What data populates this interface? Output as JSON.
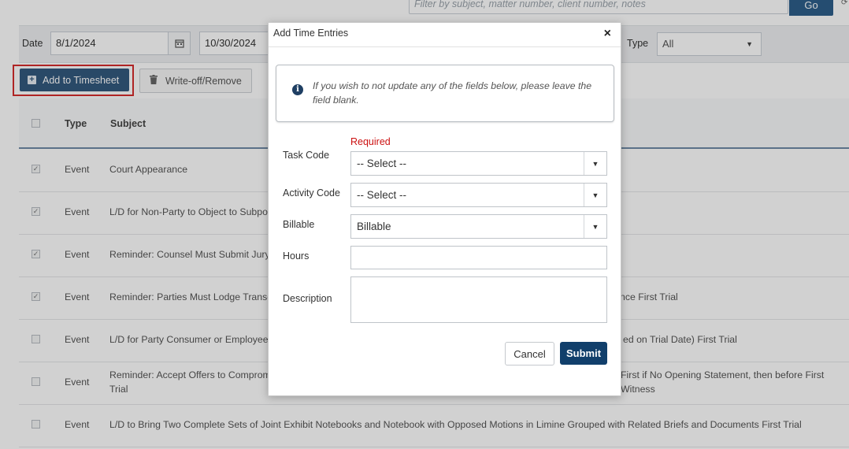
{
  "topbar": {
    "filter_placeholder": "Filter by subject, matter number, client number, notes",
    "go_label": "Go"
  },
  "filters": {
    "date_label": "Date",
    "start_date": "8/1/2024",
    "end_date": "10/30/2024",
    "type_label": "Type",
    "type_value": "All"
  },
  "actions": {
    "add_label": "Add to Timesheet",
    "writeoff_label": "Write-off/Remove"
  },
  "grid": {
    "columns": [
      "Type",
      "Subject"
    ],
    "rows": [
      {
        "checked": true,
        "type": "Event",
        "subject": "Court Appearance",
        "right": ""
      },
      {
        "checked": true,
        "type": "Event",
        "subject": "L/D for Non-Party to Object to Subpoe",
        "right": ""
      },
      {
        "checked": true,
        "type": "Event",
        "subject": "Reminder: Counsel Must Submit Jury I",
        "right": ""
      },
      {
        "checked": true,
        "type": "Event",
        "subject": "Reminder: Parties Must Lodge Transcr",
        "right": "nce First Trial"
      },
      {
        "checked": false,
        "type": "Event",
        "subject": "L/D for Party Consumer or Employee t",
        "right": "ed on Trial Date) First Trial"
      },
      {
        "checked": false,
        "type": "Event",
        "subject": "Reminder: Accept Offers to Compromis",
        "subject2": "Trial",
        "right": "First if No Opening Statement, then before First Witness"
      },
      {
        "checked": false,
        "type": "Event",
        "subject": "L/D to Bring Two Complete Sets of Joint Exhibit Notebooks and Notebook with Opposed Motions in Limine Grouped with Related Briefs and Documents First Trial",
        "right": ""
      }
    ]
  },
  "modal": {
    "title": "Add Time Entries",
    "close": "×",
    "info_text": "If you wish to not update any of the fields below, please leave the field blank.",
    "required_label": "Required",
    "task_code_label": "Task Code",
    "task_code_value": "-- Select --",
    "activity_code_label": "Activity Code",
    "activity_code_value": "-- Select --",
    "billable_label": "Billable",
    "billable_value": "Billable",
    "hours_label": "Hours",
    "description_label": "Description",
    "cancel_label": "Cancel",
    "submit_label": "Submit"
  },
  "icons": {
    "info": "info-circle-icon",
    "calendar": "calendar-icon",
    "plus": "plus-square-icon",
    "trash": "trash-icon",
    "dropdown": "caret-down-icon",
    "close": "close-icon"
  }
}
